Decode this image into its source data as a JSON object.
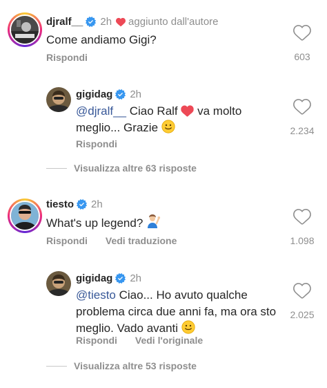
{
  "comments": [
    {
      "username": "djralf__",
      "time": "2h",
      "author_note": "aggiunto dall'autore",
      "text": "Come andiamo Gigi?",
      "reply_label": "Rispondi",
      "likes": "603",
      "replies": [
        {
          "username": "gigidag",
          "time": "2h",
          "mention": "@djralf__",
          "text_before_emoji": " Ciao Ralf ",
          "text_after_emoji": " va molto meglio... Grazie ",
          "reply_label": "Rispondi",
          "likes": "2.234"
        }
      ],
      "more_replies": "Visualizza altre 63 risposte"
    },
    {
      "username": "tiesto",
      "time": "2h",
      "text": "What's up legend? ",
      "reply_label": "Rispondi",
      "translate_label": "Vedi traduzione",
      "likes": "1.098",
      "replies": [
        {
          "username": "gigidag",
          "time": "2h",
          "mention": "@tiesto",
          "text": " Ciao... Ho avuto qualche problema circa due anni fa, ma ora sto meglio. Vado avanti ",
          "reply_label": "Rispondi",
          "original_label": "Vedi l'originale",
          "likes": "2.025"
        }
      ],
      "more_replies": "Visualizza altre 53 risposte"
    }
  ],
  "colors": {
    "text": "#262626",
    "secondary": "#8e8e8e",
    "verified": "#3897f0",
    "heart": "#ed4956",
    "mention": "#385898"
  },
  "icons": {
    "verified": "verified-badge-icon",
    "heart_outline": "heart-outline-icon",
    "heart_filled": "heart-filled-icon",
    "emoji_smile": "slightly-smiling-face-emoji",
    "emoji_shrug": "person-raising-hand-emoji",
    "emoji_heart": "red-heart-emoji"
  }
}
